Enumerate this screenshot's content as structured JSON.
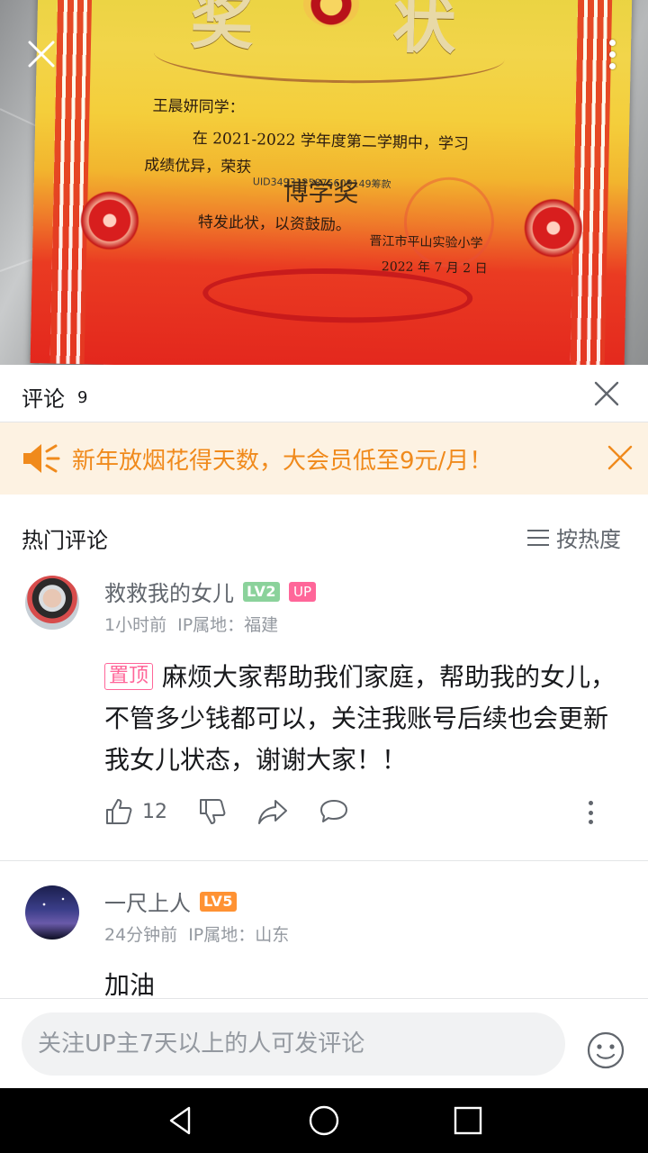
{
  "photo": {
    "certificate": {
      "title_left": "奖",
      "title_right": "状",
      "recipient": "王晨妍同学：",
      "line1": "在 2021-2022 学年度第二学期中，学习",
      "line2": "成绩优异，荣获",
      "award": "博学奖",
      "line3": "特发此状，以资鼓励。",
      "issuer": "晋江市平山实验小学",
      "date": "2022 年 7 月 2 日",
      "watermark": "UID3493125875609149筹款"
    }
  },
  "panel": {
    "title": "评论",
    "count": "9"
  },
  "promo": {
    "text": "新年放烟花得天数，大会员低至9元/月！",
    "accent_color": "#f08a1c"
  },
  "section": {
    "title": "热门评论",
    "sort_label": "按热度"
  },
  "comments": [
    {
      "username": "救救我的女儿",
      "level": "LV2",
      "up_badge": "UP",
      "time": "1小时前",
      "ip": "IP属地：福建",
      "pinned_tag": "置顶",
      "text": "麻烦大家帮助我们家庭，帮助我的女儿，不管多少钱都可以，关注我账号后续也会更新我女儿状态，谢谢大家！！",
      "likes": "12"
    },
    {
      "username": "一尺上人",
      "level": "LV5",
      "time": "24分钟前",
      "ip": "IP属地：山东",
      "text": "加油"
    }
  ],
  "input": {
    "placeholder": "关注UP主7天以上的人可发评论"
  },
  "icons": {
    "close": "close-icon",
    "more": "more-vertical-icon",
    "speaker": "speaker-icon",
    "sort": "list-icon",
    "like": "thumbs-up-icon",
    "dislike": "thumbs-down-icon",
    "share": "share-icon",
    "reply": "chat-bubble-icon",
    "emoji": "emoji-icon",
    "back": "nav-back-icon",
    "home": "nav-home-icon",
    "recents": "nav-recents-icon"
  }
}
